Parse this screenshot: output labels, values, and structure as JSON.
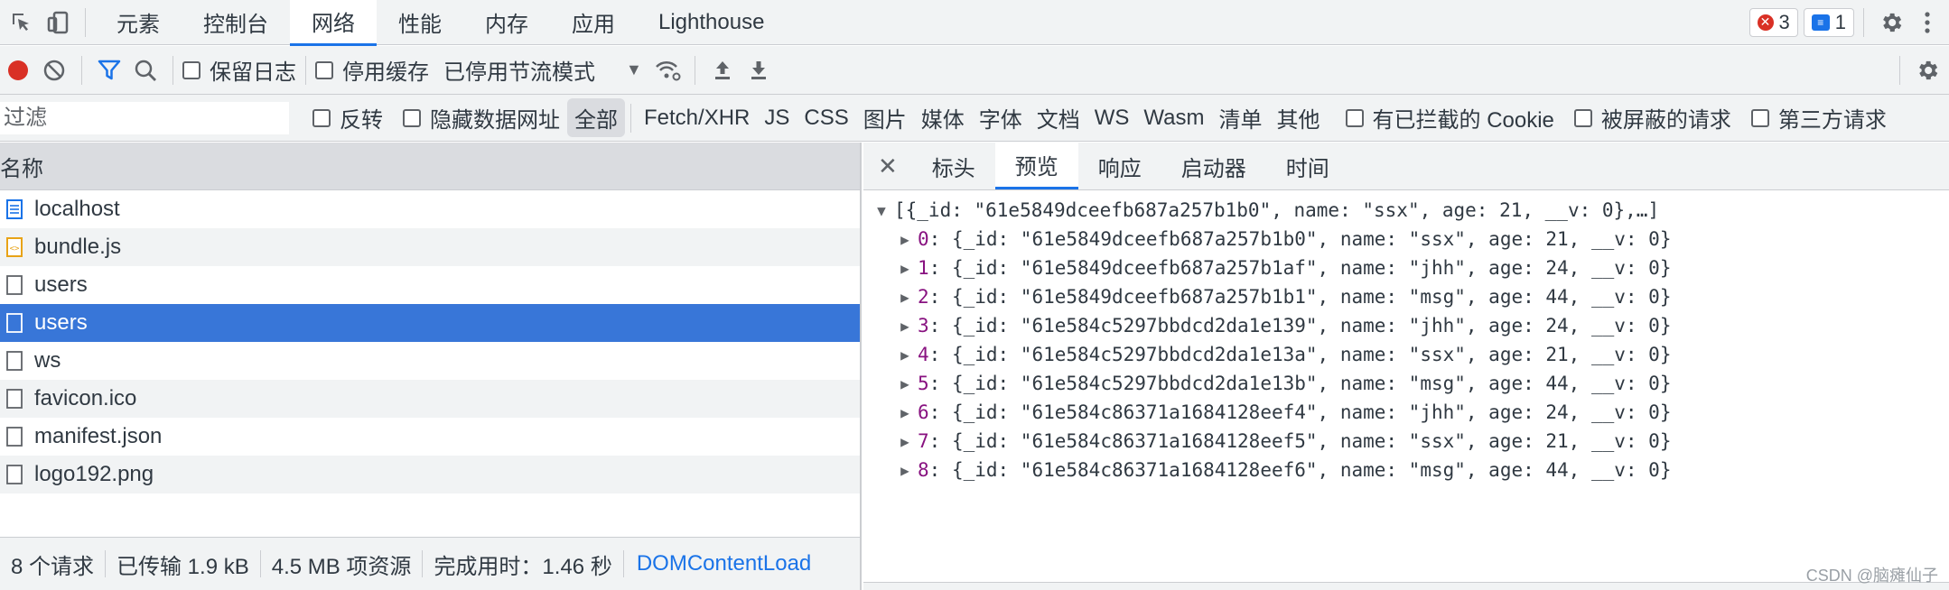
{
  "topbar": {
    "tabs": [
      {
        "label": "元素"
      },
      {
        "label": "控制台"
      },
      {
        "label": "网络"
      },
      {
        "label": "性能"
      },
      {
        "label": "内存"
      },
      {
        "label": "应用"
      },
      {
        "label": "Lighthouse"
      }
    ],
    "active_tab": "网络",
    "error_count": "3",
    "message_count": "1"
  },
  "toolbar": {
    "preserve_log": "保留日志",
    "disable_cache": "停用缓存",
    "throttling": "已停用节流模式"
  },
  "filterbar": {
    "placeholder": "过滤",
    "invert": "反转",
    "hide_data_urls": "隐藏数据网址",
    "types": [
      "全部",
      "Fetch/XHR",
      "JS",
      "CSS",
      "图片",
      "媒体",
      "字体",
      "文档",
      "WS",
      "Wasm",
      "清单",
      "其他"
    ],
    "blocked_cookies": "有已拦截的 Cookie",
    "blocked_requests": "被屏蔽的请求",
    "third_party": "第三方请求"
  },
  "requests": {
    "header": "名称",
    "items": [
      {
        "name": "localhost",
        "icon": "document-icon"
      },
      {
        "name": "bundle.js",
        "icon": "script-icon"
      },
      {
        "name": "users",
        "icon": "file-icon"
      },
      {
        "name": "users",
        "icon": "file-icon",
        "selected": true
      },
      {
        "name": "ws",
        "icon": "file-icon"
      },
      {
        "name": "favicon.ico",
        "icon": "file-icon"
      },
      {
        "name": "manifest.json",
        "icon": "file-icon"
      },
      {
        "name": "logo192.png",
        "icon": "file-icon"
      }
    ]
  },
  "summary": {
    "requests": "8 个请求",
    "transferred": "已传输 1.9 kB",
    "resources": "4.5 MB 项资源",
    "finish": "完成用时：1.46 秒",
    "domcontent": "DOMContentLoad"
  },
  "detail": {
    "tabs": [
      "标头",
      "预览",
      "响应",
      "启动器",
      "时间"
    ],
    "active_tab": "预览",
    "root": "[{_id: \"61e5849dceefb687a257b1b0\", name: \"ssx\", age: 21, __v: 0},…]",
    "entries": [
      {
        "index": "0",
        "text": "{_id: \"61e5849dceefb687a257b1b0\", name: \"ssx\", age: 21, __v: 0}"
      },
      {
        "index": "1",
        "text": "{_id: \"61e5849dceefb687a257b1af\", name: \"jhh\", age: 24, __v: 0}"
      },
      {
        "index": "2",
        "text": "{_id: \"61e5849dceefb687a257b1b1\", name: \"msg\", age: 44, __v: 0}"
      },
      {
        "index": "3",
        "text": "{_id: \"61e584c5297bbdcd2da1e139\", name: \"jhh\", age: 24, __v: 0}"
      },
      {
        "index": "4",
        "text": "{_id: \"61e584c5297bbdcd2da1e13a\", name: \"ssx\", age: 21, __v: 0}"
      },
      {
        "index": "5",
        "text": "{_id: \"61e584c5297bbdcd2da1e13b\", name: \"msg\", age: 44, __v: 0}"
      },
      {
        "index": "6",
        "text": "{_id: \"61e584c86371a1684128eef4\", name: \"jhh\", age: 24, __v: 0}"
      },
      {
        "index": "7",
        "text": "{_id: \"61e584c86371a1684128eef5\", name: \"ssx\", age: 21, __v: 0}"
      },
      {
        "index": "8",
        "text": "{_id: \"61e584c86371a1684128eef6\", name: \"msg\", age: 44, __v: 0}"
      }
    ]
  },
  "watermark": "CSDN @脑瘫仙子",
  "colors": {
    "accent": "#1a73e8",
    "selected_row": "#3876d8",
    "record": "#d93025",
    "key": "#881280"
  }
}
